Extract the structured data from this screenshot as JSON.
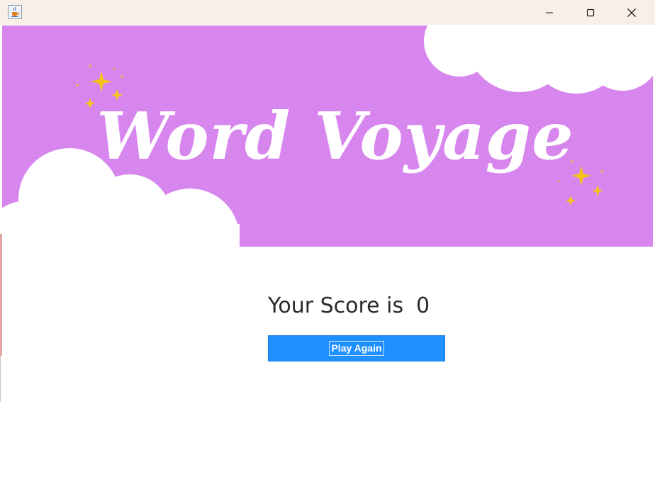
{
  "window": {
    "icon": "java-cup-icon",
    "controls": {
      "minimize_icon": "minimize-icon",
      "maximize_icon": "maximize-icon",
      "close_icon": "close-icon"
    }
  },
  "banner": {
    "title": "Word Voyage",
    "background_color": "#d786ee",
    "title_color": "#ffffff",
    "sparkle_color": "#f6c21c"
  },
  "score": {
    "label": "Your Score is",
    "value": "0"
  },
  "play_again": {
    "label": "Play Again",
    "color": "#1e90ff"
  }
}
